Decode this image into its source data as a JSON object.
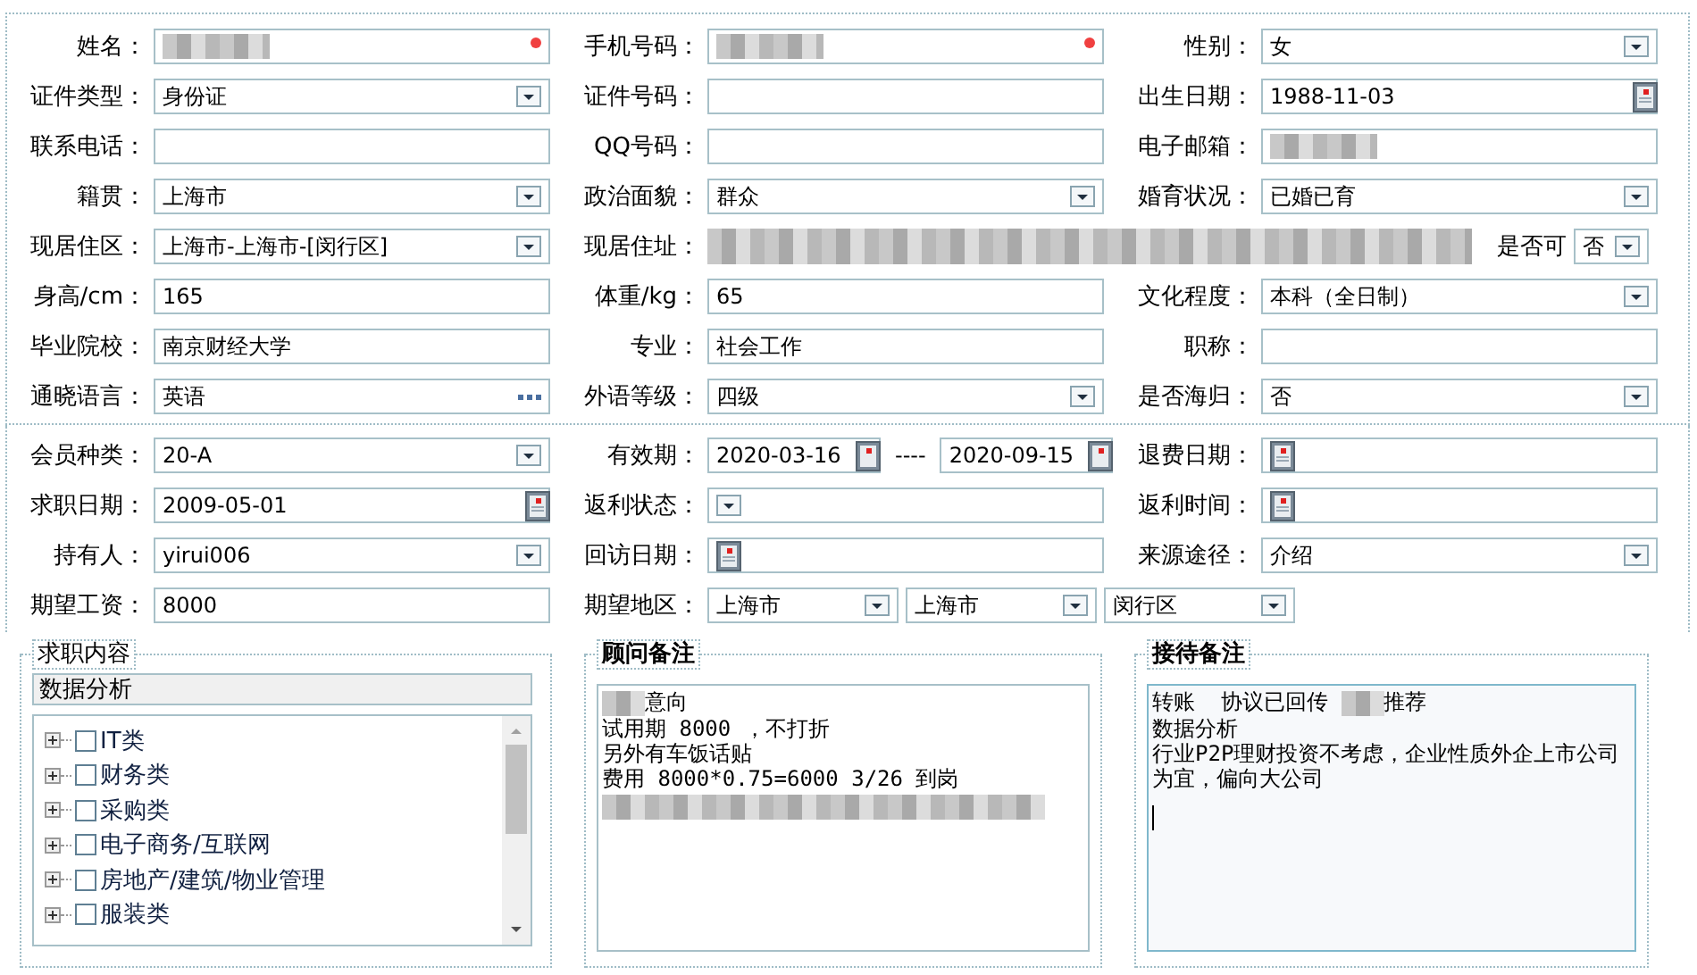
{
  "sections": [
    {
      "rows": [
        [
          {
            "kind": "text",
            "label": "姓名：",
            "redacted": true,
            "required": true
          },
          {
            "kind": "text",
            "label": "手机号码：",
            "redacted": true,
            "required": true
          },
          {
            "kind": "select",
            "label": "性别：",
            "value": "女"
          }
        ],
        [
          {
            "kind": "select",
            "label": "证件类型：",
            "value": "身份证"
          },
          {
            "kind": "text",
            "label": "证件号码："
          },
          {
            "kind": "date",
            "label": "出生日期：",
            "value": "1988-11-03"
          }
        ],
        [
          {
            "kind": "text",
            "label": "联系电话："
          },
          {
            "kind": "text",
            "label": "QQ号码："
          },
          {
            "kind": "text",
            "label": "电子邮箱：",
            "redacted": true
          }
        ],
        [
          {
            "kind": "select",
            "label": "籍贯：",
            "value": "上海市"
          },
          {
            "kind": "select",
            "label": "政治面貌：",
            "value": "群众"
          },
          {
            "kind": "select",
            "label": "婚育状况：",
            "value": "已婚已育"
          }
        ],
        [
          {
            "kind": "select",
            "label": "现居住区：",
            "value": "上海市-上海市-[闵行区]"
          },
          {
            "kind": "address",
            "label": "现居住址：",
            "option_label": "是否可",
            "option_value": "否"
          }
        ],
        [
          {
            "kind": "text",
            "label": "身高/cm：",
            "value": "165"
          },
          {
            "kind": "text",
            "label": "体重/kg：",
            "value": "65"
          },
          {
            "kind": "select",
            "label": "文化程度：",
            "value": "本科（全日制）"
          }
        ],
        [
          {
            "kind": "text",
            "label": "毕业院校：",
            "value": "南京财经大学"
          },
          {
            "kind": "text",
            "label": "专业：",
            "value": "社会工作"
          },
          {
            "kind": "text",
            "label": "职称："
          }
        ],
        [
          {
            "kind": "lookup",
            "label": "通晓语言：",
            "value": "英语"
          },
          {
            "kind": "select",
            "label": "外语等级：",
            "value": "四级"
          },
          {
            "kind": "select",
            "label": "是否海归：",
            "value": "否"
          }
        ]
      ]
    },
    {
      "rows": [
        [
          {
            "kind": "select",
            "label": "会员种类：",
            "value": "20-A"
          },
          {
            "kind": "range",
            "label": "有效期：",
            "from": "2020-03-16",
            "separator": "----",
            "to": "2020-09-15"
          },
          {
            "kind": "date",
            "label": "退费日期："
          }
        ],
        [
          {
            "kind": "date",
            "label": "求职日期：",
            "value": "2009-05-01"
          },
          {
            "kind": "select",
            "label": "返利状态："
          },
          {
            "kind": "date",
            "label": "返利时间："
          }
        ],
        [
          {
            "kind": "select",
            "label": "持有人：",
            "value": "yirui006"
          },
          {
            "kind": "date",
            "label": "回访日期："
          },
          {
            "kind": "select",
            "label": "来源途径：",
            "value": "介绍"
          }
        ],
        [
          {
            "kind": "text",
            "label": "期望工资：",
            "value": "8000"
          },
          {
            "kind": "region",
            "label": "期望地区：",
            "values": [
              "上海市",
              "上海市",
              "闵行区"
            ]
          }
        ]
      ]
    }
  ],
  "panels": [
    {
      "kind": "tree",
      "title": "求职内容",
      "search": "数据分析",
      "items": [
        {
          "label": "IT类",
          "checked": false,
          "expanded": false
        },
        {
          "label": "财务类",
          "checked": false,
          "expanded": false
        },
        {
          "label": "采购类",
          "checked": false,
          "expanded": false
        },
        {
          "label": "电子商务/互联网",
          "checked": false,
          "expanded": false
        },
        {
          "label": "房地产/建筑/物业管理",
          "checked": false,
          "expanded": false
        },
        {
          "label": "服装类",
          "checked": false,
          "expanded": false
        }
      ]
    },
    {
      "kind": "notes",
      "title": "顾问备注",
      "focused": false,
      "lines": [
        [
          {
            "kind": "redacted-short"
          },
          {
            "kind": "text",
            "text": "意向"
          }
        ],
        [
          {
            "kind": "text",
            "text": "试用期 8000 ，不打折"
          }
        ],
        [
          {
            "kind": "text",
            "text": "另外有车饭话贴"
          }
        ],
        [
          {
            "kind": "text",
            "text": "费用 8000*0.75=6000 3/26 到岗"
          }
        ],
        [
          {
            "kind": "redacted-long"
          }
        ]
      ]
    },
    {
      "kind": "notes",
      "title": "接待备注",
      "focused": true,
      "lines": [
        [
          {
            "kind": "text",
            "text": "转账  协议已回传 "
          },
          {
            "kind": "redacted-short"
          },
          {
            "kind": "text",
            "text": "推荐"
          }
        ],
        [
          {
            "kind": "text",
            "text": "数据分析"
          }
        ],
        [
          {
            "kind": "text",
            "text": "行业P2P理财投资不考虑，企业性质外企上市公司"
          }
        ],
        [
          {
            "kind": "text",
            "text": "为宜，偏向大公司"
          }
        ]
      ]
    }
  ]
}
